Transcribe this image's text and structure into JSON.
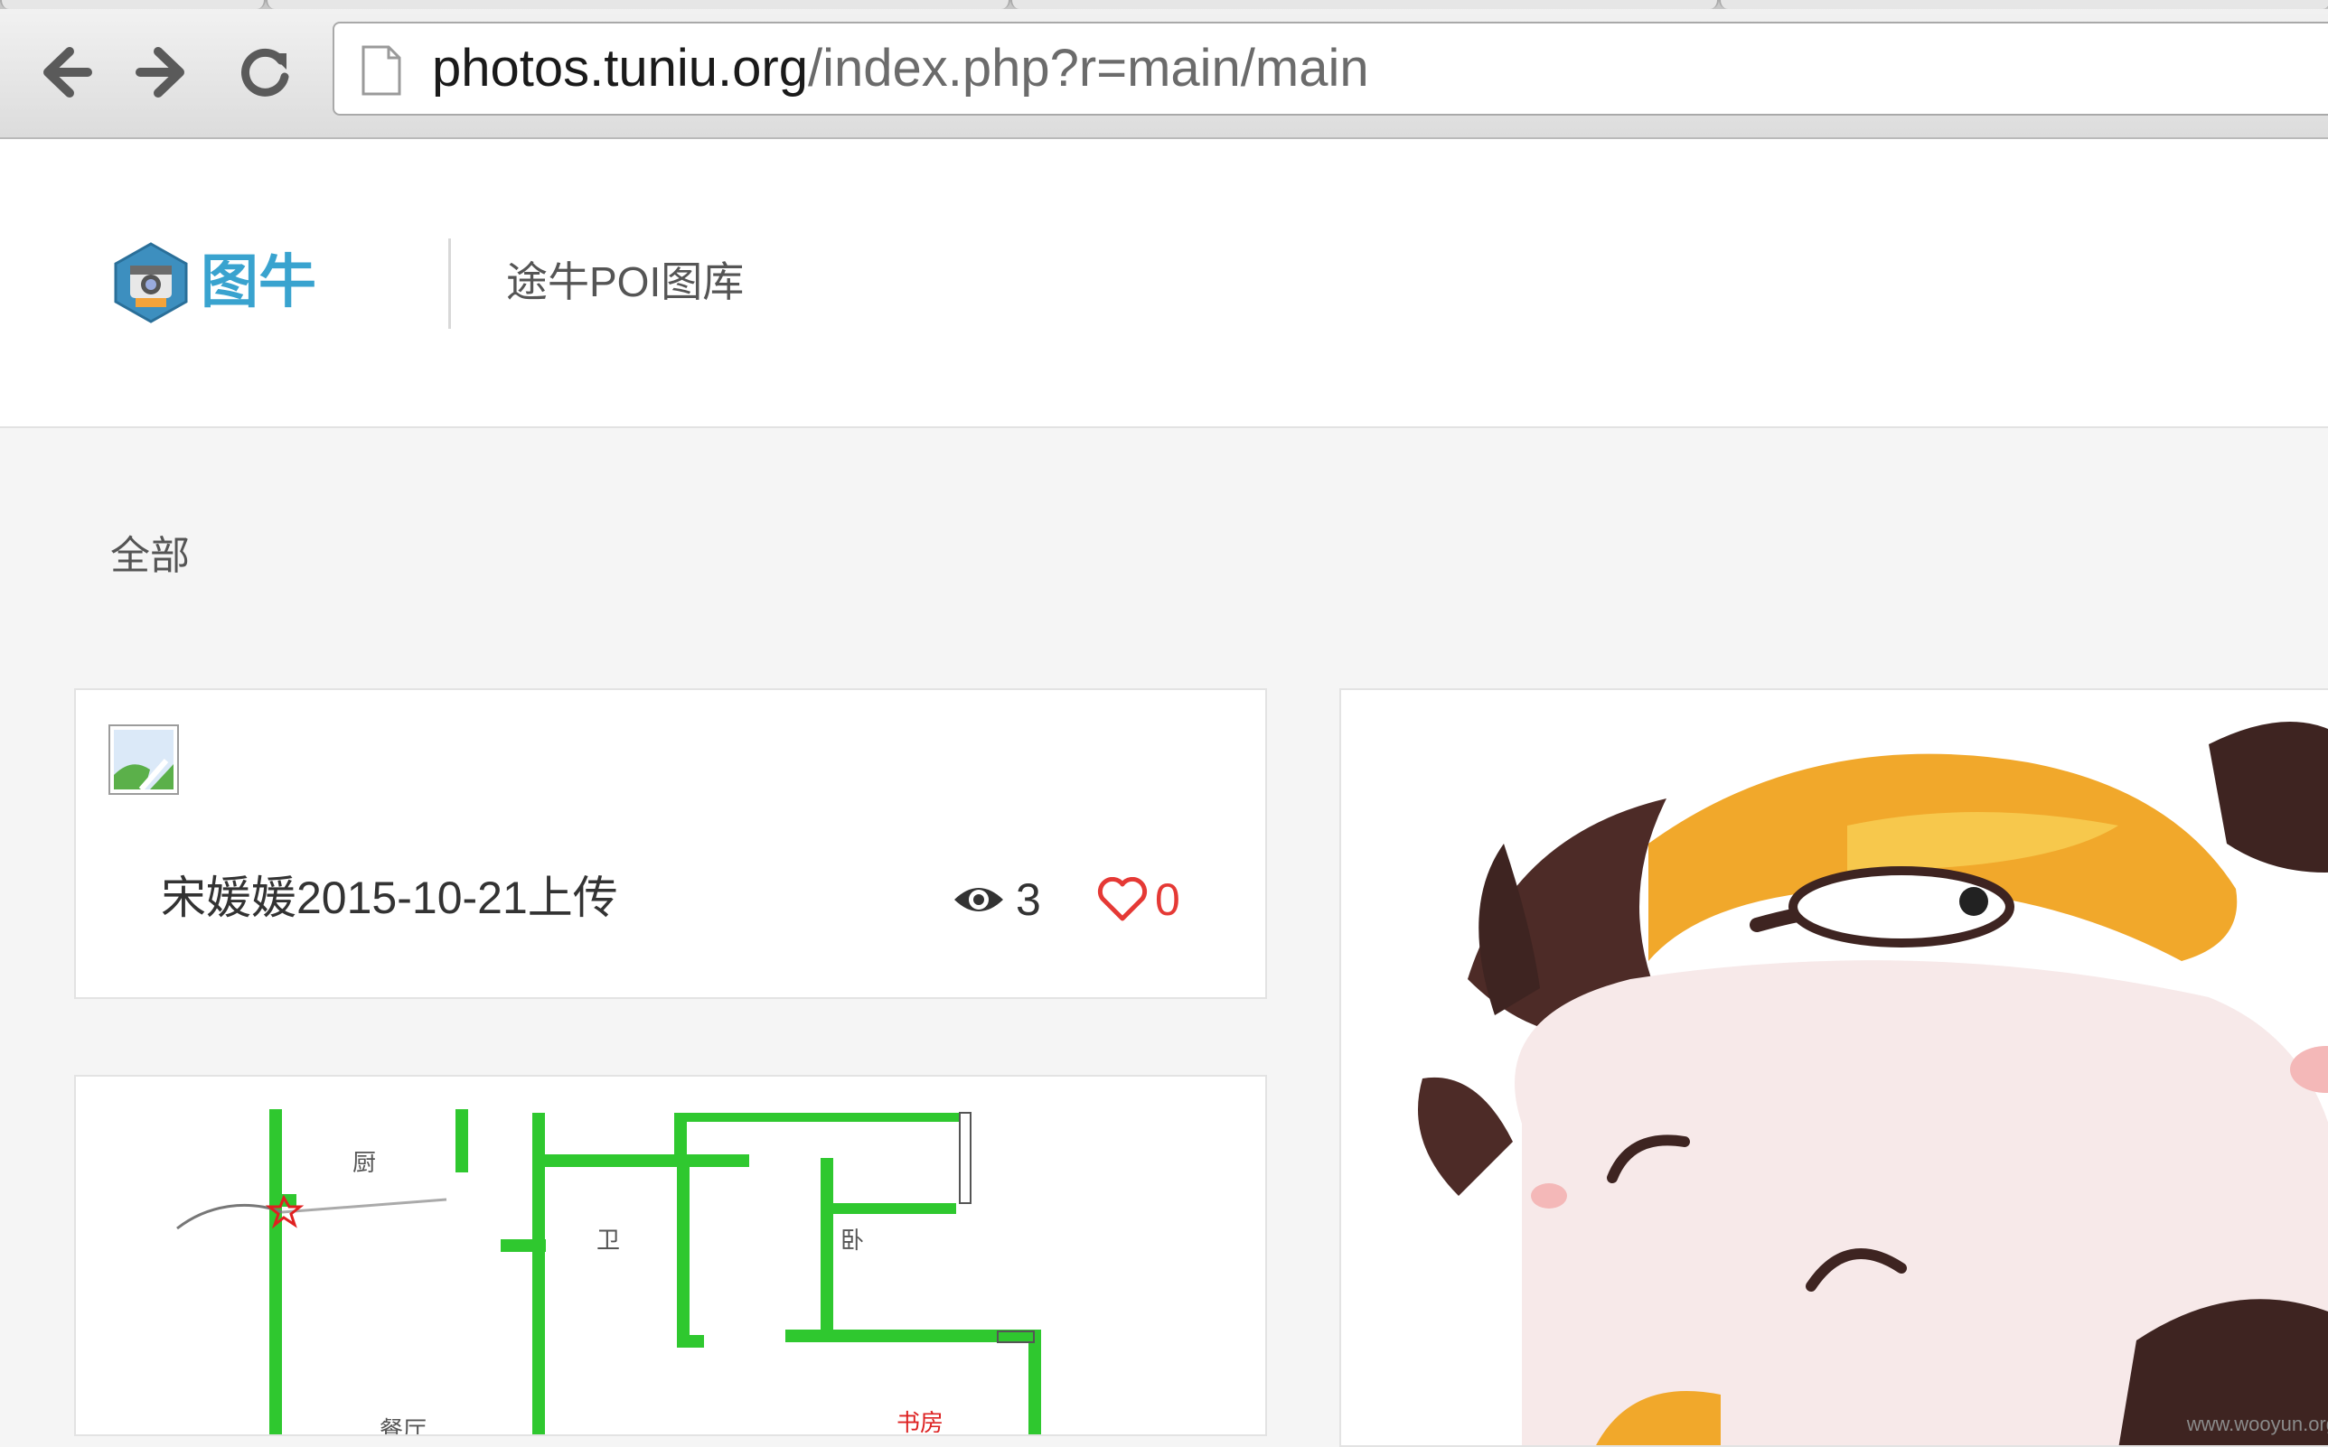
{
  "browser": {
    "url_host": "photos.tuniu.org",
    "url_path": "/index.php?r=main/main",
    "back_icon": "arrow-left-icon",
    "forward_icon": "arrow-right-icon",
    "reload_icon": "reload-icon",
    "page_icon": "document-icon"
  },
  "header": {
    "logo_text": "图牛",
    "site_title": "途牛POI图库"
  },
  "filters": {
    "active": "全部"
  },
  "photos": [
    {
      "uploader_line": "宋媛媛2015-10-21上传",
      "views": "3",
      "likes": "0",
      "image": "broken-image-icon"
    },
    {
      "floorplan_labels": [
        "厨",
        "卫",
        "卧",
        "书房",
        "餐厅"
      ]
    },
    {
      "image": "cartoon-cow-image"
    }
  ],
  "watermark": "www.wooyun.org",
  "colors": {
    "brand": "#39a3cf",
    "like": "#e53935",
    "wall": "#2fc82f"
  }
}
